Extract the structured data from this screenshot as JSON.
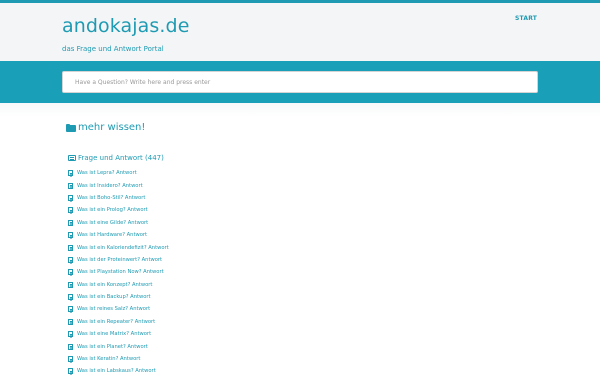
{
  "header": {
    "site_title": "andokajas.de",
    "tagline": "das Frage und Antwort Portal",
    "nav_start": "START"
  },
  "search": {
    "placeholder": "Have a Question? Write here and press enter"
  },
  "section": {
    "title": "mehr wissen!"
  },
  "category": {
    "title": "Frage und Antwort (447)"
  },
  "items": [
    "Was ist Lepra? Antwort",
    "Was ist Insidero? Antwort",
    "Was ist Boho-Stil? Antwort",
    "Was ist ein Prolog? Antwort",
    "Was ist eine Gilde? Antwort",
    "Was ist Hardware? Antwort",
    "Was ist ein Kaloriendefizit? Antwort",
    "Was ist der Proteinwert? Antwort",
    "Was ist Playstation Now? Antwort",
    "Was ist ein Konzept? Antwort",
    "Was ist ein Backup? Antwort",
    "Was ist reines Salz? Antwort",
    "Was ist ein Repeater? Antwort",
    "Was ist eine Matrix? Antwort",
    "Was ist ein Planet? Antwort",
    "Was ist Keratin? Antwort",
    "Was ist ein Labskaus? Antwort"
  ],
  "colors": {
    "accent": "#1e9bb3",
    "search_band": "#1a9fb8",
    "header_bg": "#f4f5f6"
  },
  "icons": {
    "section": "folder-icon",
    "category": "list-icon",
    "item": "document-icon"
  }
}
